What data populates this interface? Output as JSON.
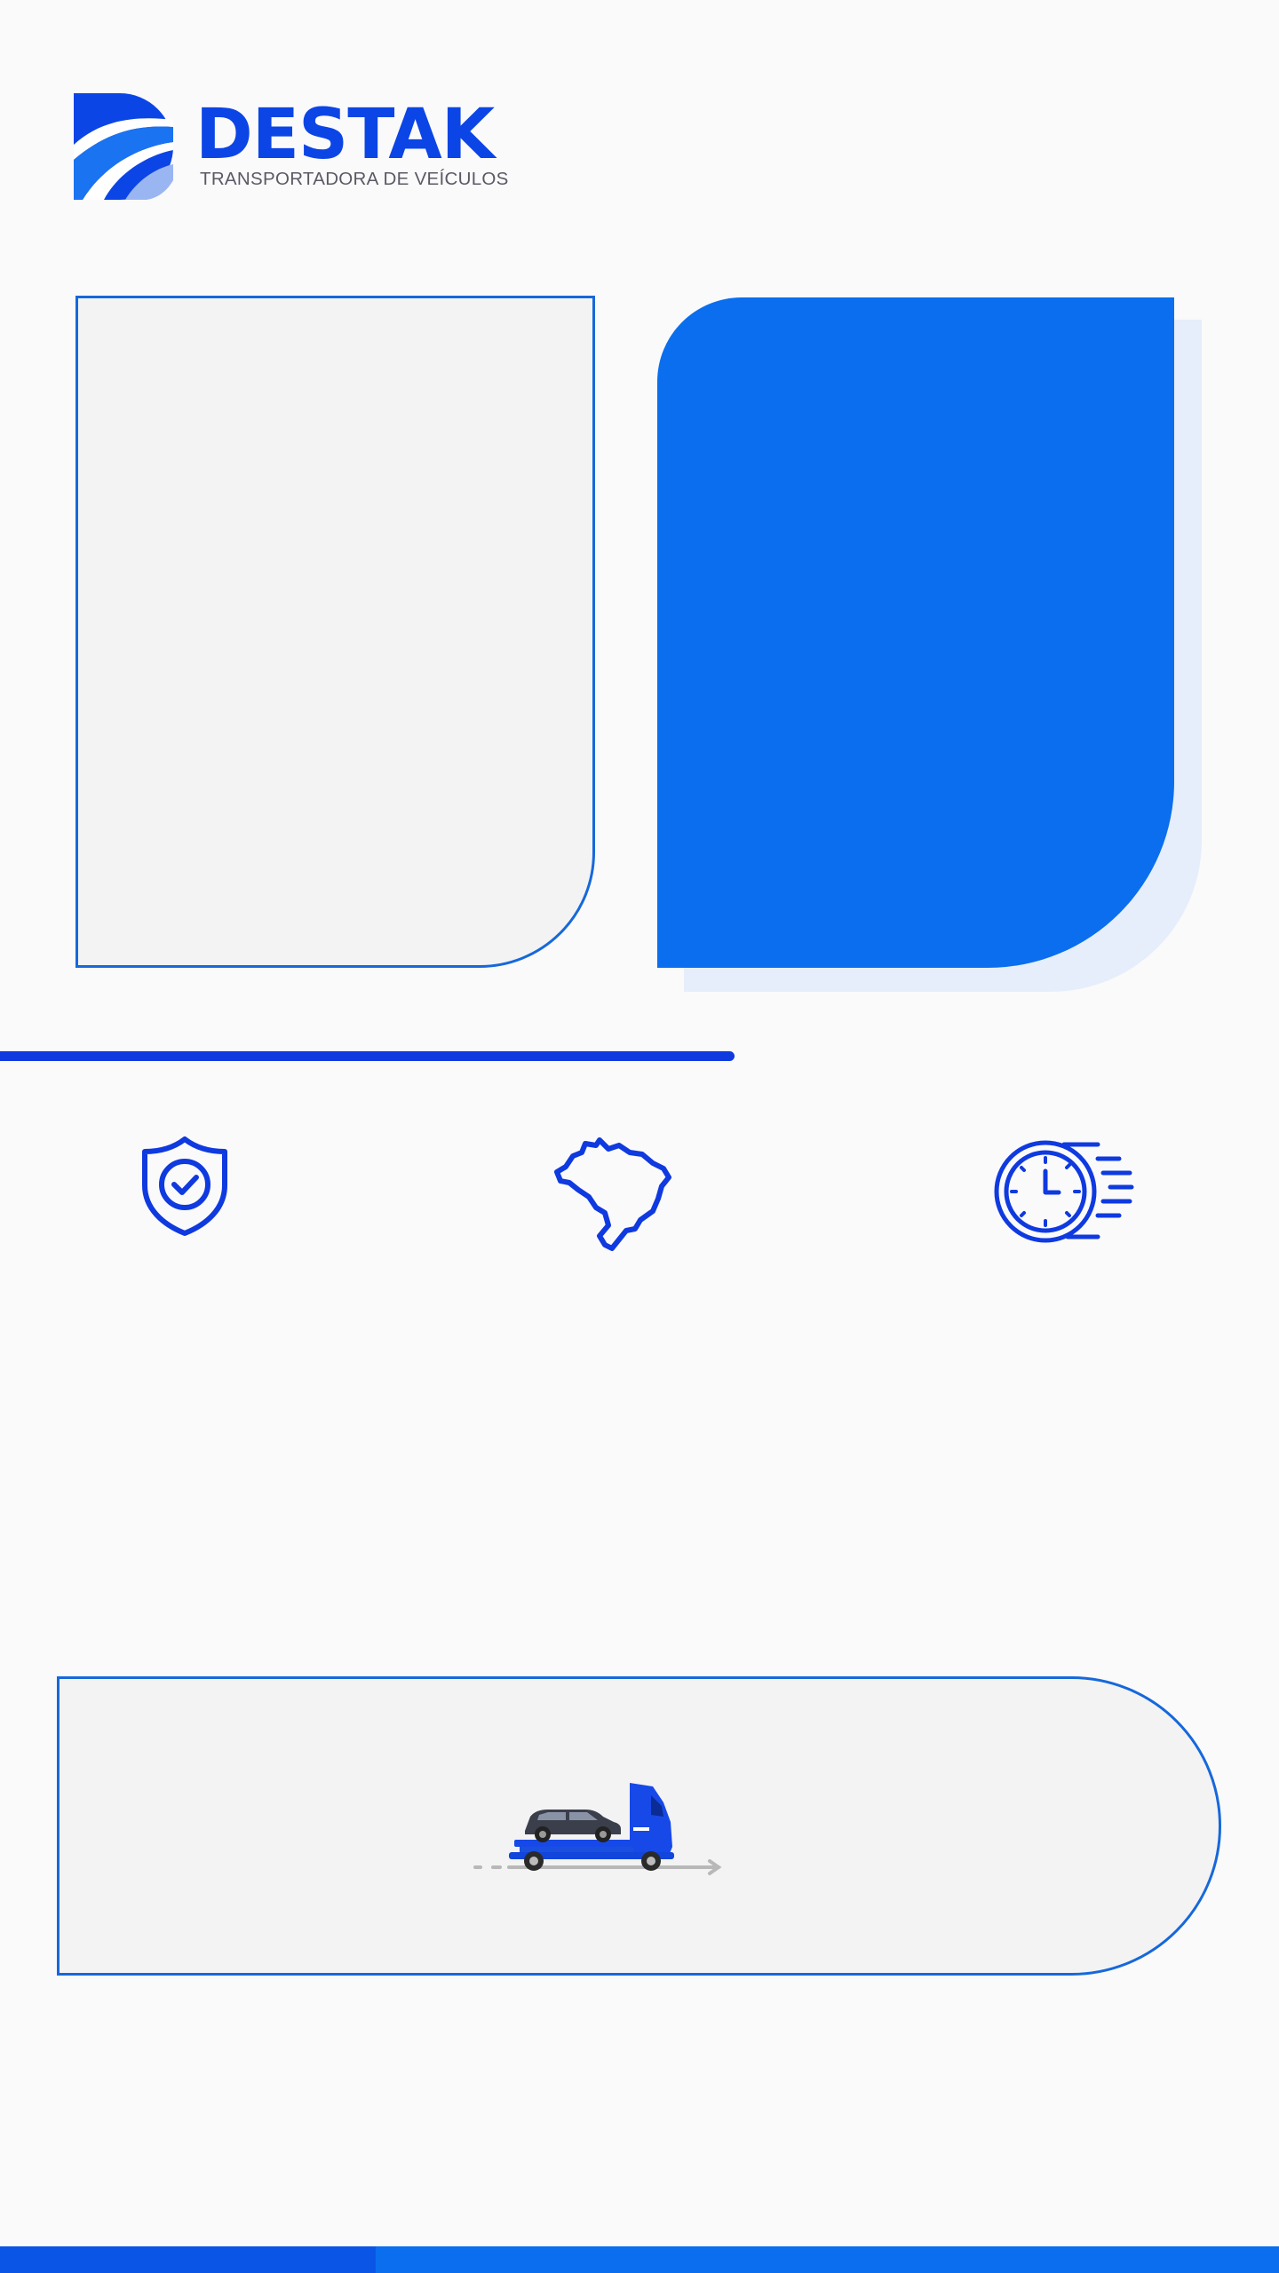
{
  "brand": {
    "name": "DESTAK",
    "tagline": "TRANSPORTADORA DE VEÍCULOS",
    "logo_icon": "road-swoosh-icon",
    "colors": {
      "primary_blue": "#0c45e6",
      "card_blue": "#0a6eee",
      "outline_blue": "#1668db",
      "card_gray": "#f3f3f3",
      "tagline_gray": "#5a5a66"
    }
  },
  "features": [
    {
      "icon": "shield-check-icon"
    },
    {
      "icon": "brazil-map-icon"
    },
    {
      "icon": "fast-clock-icon"
    }
  ],
  "banner": {
    "illustration": "car-carrier-truck-icon"
  }
}
